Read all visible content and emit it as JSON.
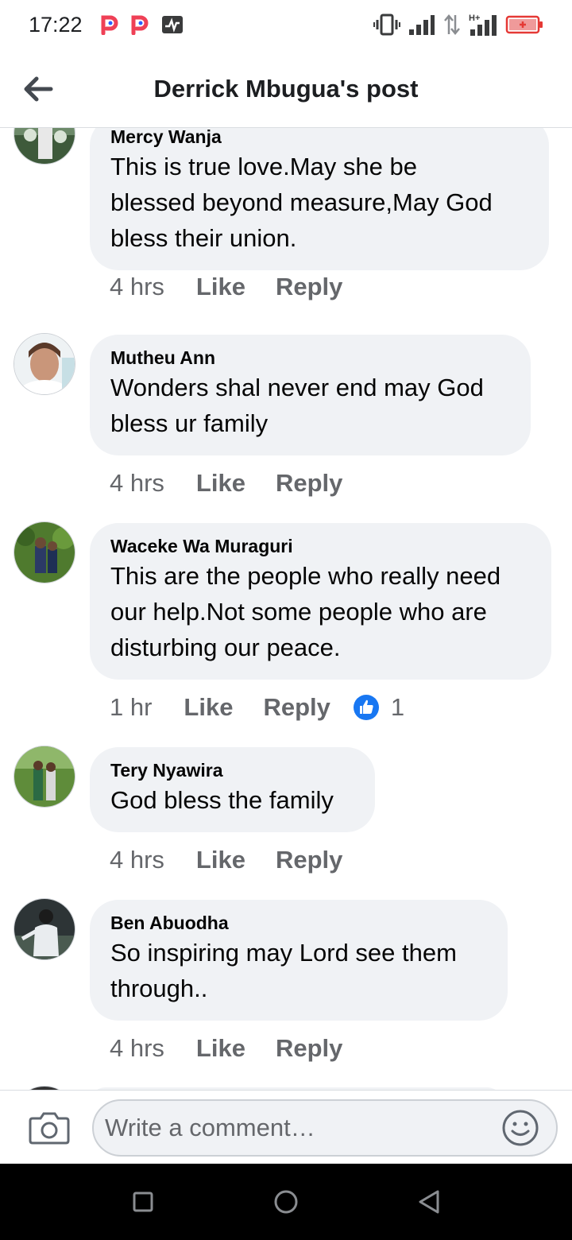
{
  "status_bar": {
    "time": "17:22",
    "left_icons": [
      "pocket-p-icon",
      "pocket-p-icon",
      "activity-monitor-icon"
    ],
    "right_icons": [
      "vibrate-icon",
      "signal-icon",
      "data-arrows-icon",
      "h-plus-signal-icon",
      "battery-icon"
    ],
    "network_label": "H+"
  },
  "header": {
    "title": "Derrick Mbugua's post",
    "back_icon": "arrow-left-icon"
  },
  "comments": [
    {
      "author": "Mercy Wanja",
      "text": "This is true love.May she be\nblessed  beyond measure,May God\nbless their union.",
      "time": "4 hrs",
      "like": "Like",
      "reply": "Reply"
    },
    {
      "author": "Mutheu Ann",
      "text": "Wonders shal never end may God\nbless ur family",
      "time": "4 hrs",
      "like": "Like",
      "reply": "Reply"
    },
    {
      "author": "Waceke Wa Muraguri",
      "text": "This are the people who really need\nour help.Not some people who are\ndisturbing our peace.",
      "time": "1 hr",
      "like": "Like",
      "reply": "Reply",
      "reaction_icon": "thumbs-up-icon",
      "reaction_count": "1"
    },
    {
      "author": "Tery Nyawira",
      "text": "God bless the family",
      "time": "4 hrs",
      "like": "Like",
      "reply": "Reply"
    },
    {
      "author": "Ben Abuodha",
      "text": "So inspiring may Lord see them\nthrough..",
      "time": "4 hrs",
      "like": "Like",
      "reply": "Reply"
    }
  ],
  "composer": {
    "placeholder": "Write a comment…",
    "camera_icon": "camera-icon",
    "emoji_icon": "smiley-icon"
  },
  "nav": {
    "icons": [
      "square-recents-icon",
      "circle-home-icon",
      "triangle-back-icon"
    ]
  },
  "colors": {
    "bubble": "#f0f2f5",
    "secondary_text": "#65676b",
    "like_blue": "#1877f2"
  }
}
